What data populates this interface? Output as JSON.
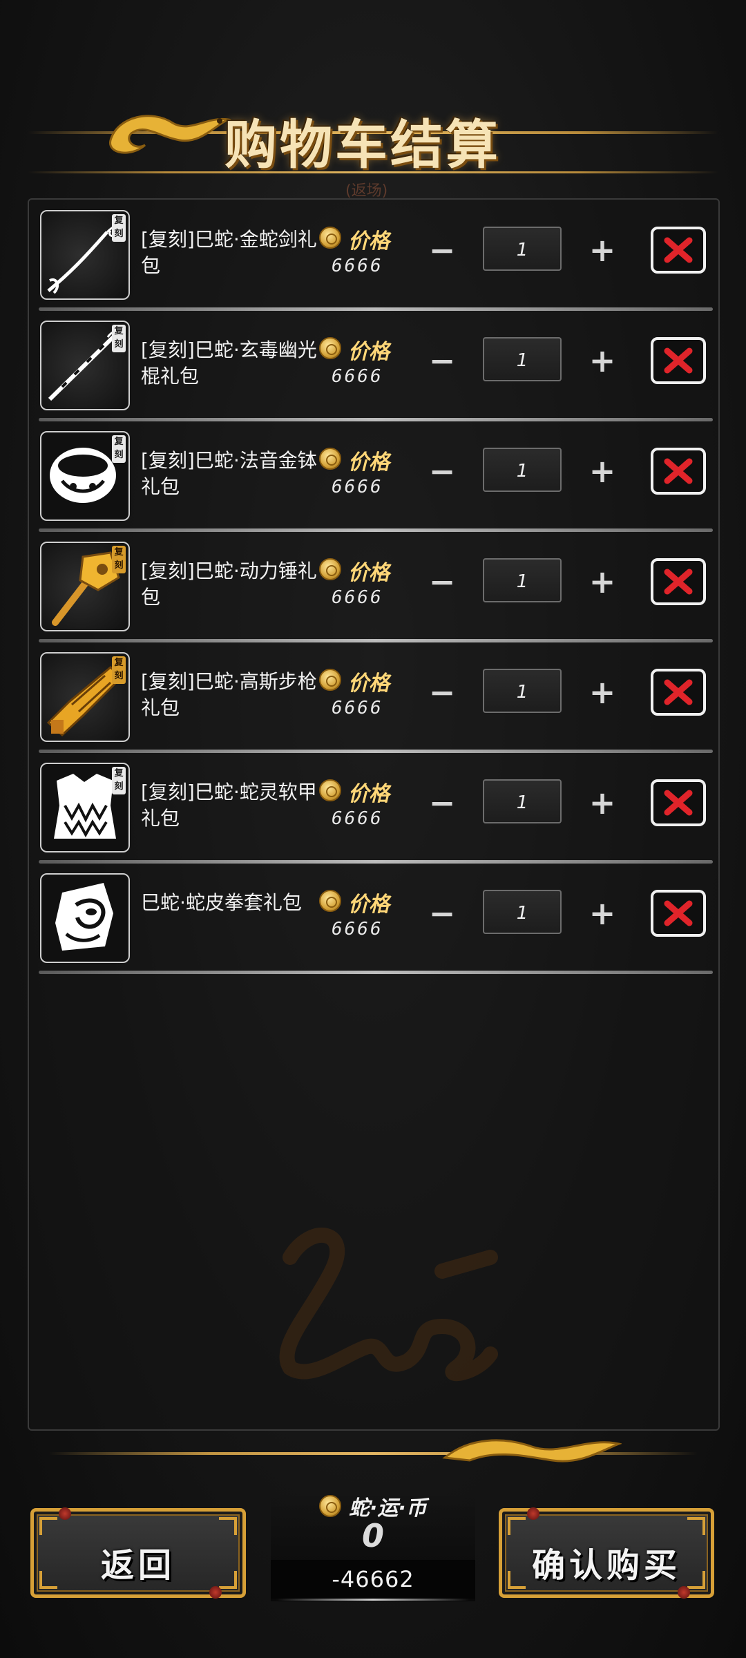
{
  "header": {
    "title": "购物车结算",
    "subtitle": "(返场)"
  },
  "price_label": "价格",
  "items": [
    {
      "name": "[复刻]巳蛇·金蛇剑礼包",
      "badge": "复刻",
      "price": "6666",
      "qty": "1",
      "icon": "golden-snake-sword-icon"
    },
    {
      "name": "[复刻]巳蛇·玄毒幽光棍礼包",
      "badge": "复刻",
      "price": "6666",
      "qty": "1",
      "icon": "venom-staff-icon"
    },
    {
      "name": "[复刻]巳蛇·法音金钵礼包",
      "badge": "复刻",
      "price": "6666",
      "qty": "1",
      "icon": "golden-bowl-icon"
    },
    {
      "name": "[复刻]巳蛇·动力锤礼包",
      "badge": "复刻",
      "price": "6666",
      "qty": "1",
      "icon": "power-hammer-icon"
    },
    {
      "name": "[复刻]巳蛇·高斯步枪礼包",
      "badge": "复刻",
      "price": "6666",
      "qty": "1",
      "icon": "gauss-rifle-icon"
    },
    {
      "name": "[复刻]巳蛇·蛇灵软甲礼包",
      "badge": "复刻",
      "price": "6666",
      "qty": "1",
      "icon": "snake-armor-icon"
    },
    {
      "name": "巳蛇·蛇皮拳套礼包",
      "badge": "",
      "price": "6666",
      "qty": "1",
      "icon": "snakeskin-gloves-icon"
    }
  ],
  "controls": {
    "minus": "−",
    "plus": "+"
  },
  "footer": {
    "back_label": "返回",
    "confirm_label": "确认购买",
    "currency_name": "蛇·运·币",
    "currency_balance": "0",
    "currency_total": "-46662"
  },
  "colors": {
    "accent_gold": "#ffd778",
    "delete_red": "#e0242a",
    "frame_gold": "#d7a037"
  }
}
